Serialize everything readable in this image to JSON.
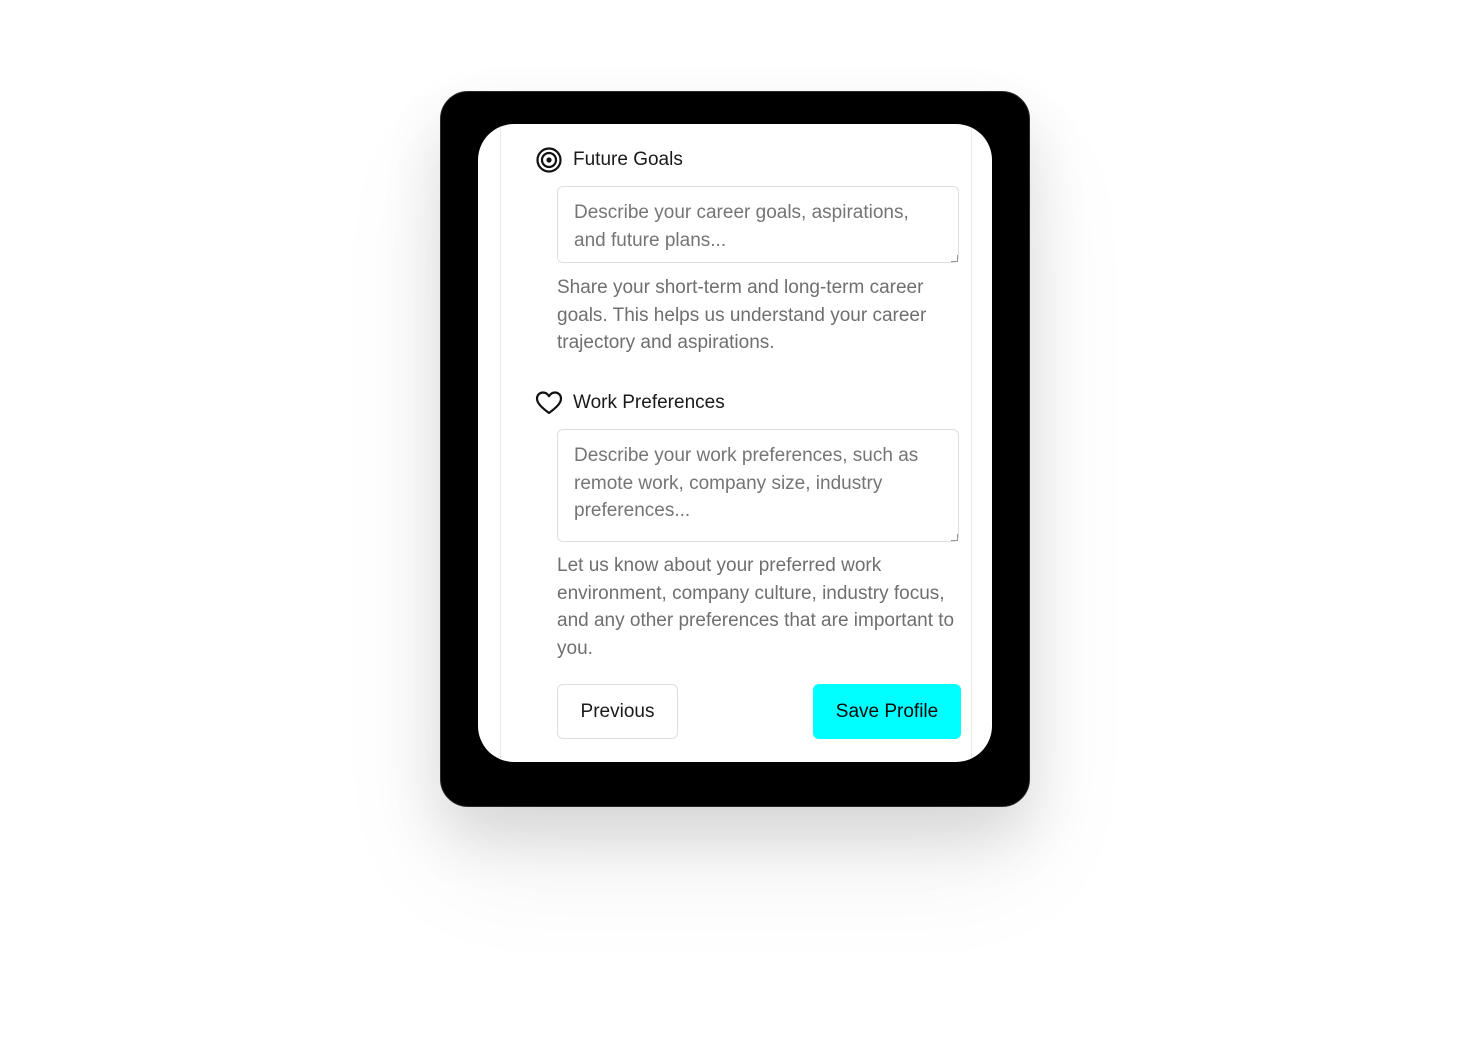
{
  "future_goals": {
    "label": "Future Goals",
    "icon": "target-icon",
    "placeholder": "Describe your career goals, aspirations, and future plans...",
    "value": "",
    "help": "Share your short-term and long-term career goals. This helps us understand your career trajectory and aspirations."
  },
  "work_preferences": {
    "label": "Work Preferences",
    "icon": "heart-icon",
    "placeholder": "Describe your work preferences, such as remote work, company size, industry preferences...",
    "value": "",
    "help": "Let us know about your preferred work environment, company culture, industry focus, and any other preferences that are important to you."
  },
  "actions": {
    "previous_label": "Previous",
    "save_label": "Save Profile"
  },
  "colors": {
    "accent": "#00ffff",
    "device_frame": "#000000",
    "help_text": "#6f6f6f"
  }
}
